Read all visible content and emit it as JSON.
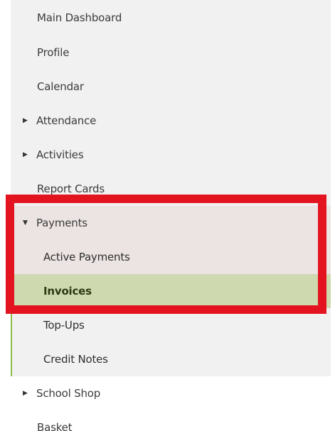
{
  "menu": {
    "main_dashboard": "Main Dashboard",
    "profile": "Profile",
    "calendar": "Calendar",
    "attendance": "Attendance",
    "activities": "Activities",
    "report_cards": "Report Cards",
    "payments": "Payments",
    "payments_sub": {
      "active_payments": "Active Payments",
      "invoices": "Invoices",
      "top_ups": "Top-Ups",
      "credit_notes": "Credit Notes"
    },
    "school_shop": "School Shop",
    "basket": "Basket"
  },
  "icons": {
    "collapsed": "caret-right-icon",
    "expanded": "caret-down-icon"
  },
  "colors": {
    "active_item": "#cfd9b0",
    "open_section": "#ece3e3",
    "active_border": "#8cbf47",
    "highlight_annotation": "#e3141f"
  }
}
